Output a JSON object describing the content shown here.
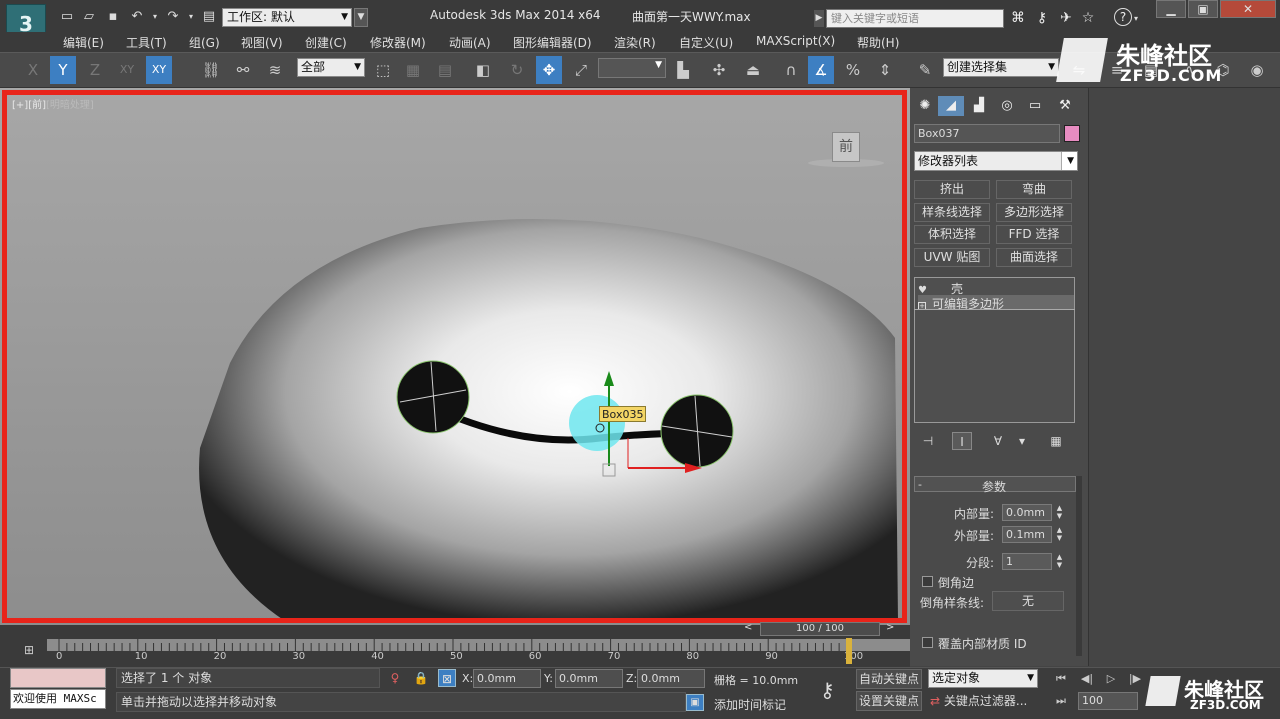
{
  "titlebar": {
    "logo_letter": "3",
    "workspace_label": "工作区: 默认",
    "app_title": "Autodesk 3ds Max  2014 x64",
    "file_title": "曲面第一天WWY.max",
    "search_placeholder": "键入关键字或短语",
    "help_label": "?"
  },
  "menu": [
    "编辑(E)",
    "工具(T)",
    "组(G)",
    "视图(V)",
    "创建(C)",
    "修改器(M)",
    "动画(A)",
    "图形编辑器(D)",
    "渲染(R)",
    "自定义(U)",
    "MAXScript(X)",
    "帮助(H)"
  ],
  "toolbar": {
    "constraint_x": "X",
    "constraint_y": "Y",
    "constraint_z": "Z",
    "constraint_xy": "XY",
    "constraint_xy2": "XY",
    "selection_filter": "全部",
    "named_selection": "创建选择集"
  },
  "watermark": {
    "brand": "朱峰社区",
    "url": "ZF3D.COM"
  },
  "viewport": {
    "label_prefix": "[+]",
    "label_view": "[前]",
    "label_mode": "[明暗处理]",
    "viewcube_label": "前",
    "object_tooltip": "Box035",
    "axis_z": "z",
    "axis_x": "x"
  },
  "command_panel": {
    "object_name": "Box037",
    "object_color": "#e78cc1",
    "modifier_list": "修改器列表",
    "modifier_buttons": [
      "挤出",
      "弯曲",
      "样条线选择",
      "多边形选择",
      "体积选择",
      "FFD 选择",
      "UVW 贴图",
      "曲面选择"
    ],
    "stack_items": [
      "壳",
      "可编辑多边形"
    ],
    "rollout_title": "参数",
    "inner_amount_label": "内部量:",
    "inner_amount_value": "0.0mm",
    "outer_amount_label": "外部量:",
    "outer_amount_value": "0.1mm",
    "segments_label": "分段:",
    "segments_value": "1",
    "bevel_edges_label": "倒角边",
    "bevel_spline_label": "倒角样条线:",
    "bevel_spline_value": "无",
    "override_inner_mat_label": "覆盖内部材质 ID"
  },
  "timeline": {
    "slider_label": "100 / 100",
    "prev": "<",
    "next": ">",
    "ticks": [
      "0",
      "10",
      "20",
      "30",
      "40",
      "50",
      "60",
      "70",
      "80",
      "90",
      "100"
    ]
  },
  "status": {
    "welcome": "欢迎使用 MAXSc",
    "selection_status": "选择了 1 个 对象",
    "prompt": "单击并拖动以选择并移动对象",
    "x_label": "X:",
    "x_value": "0.0mm",
    "y_label": "Y:",
    "y_value": "0.0mm",
    "z_label": "Z:",
    "z_value": "0.0mm",
    "grid": "栅格 = 10.0mm",
    "add_time_tag": "添加时间标记",
    "auto_key": "自动关键点",
    "set_key": "设置关键点",
    "selected_object": "选定对象",
    "key_filters": "关键点过滤器...",
    "current_frame": "100"
  }
}
